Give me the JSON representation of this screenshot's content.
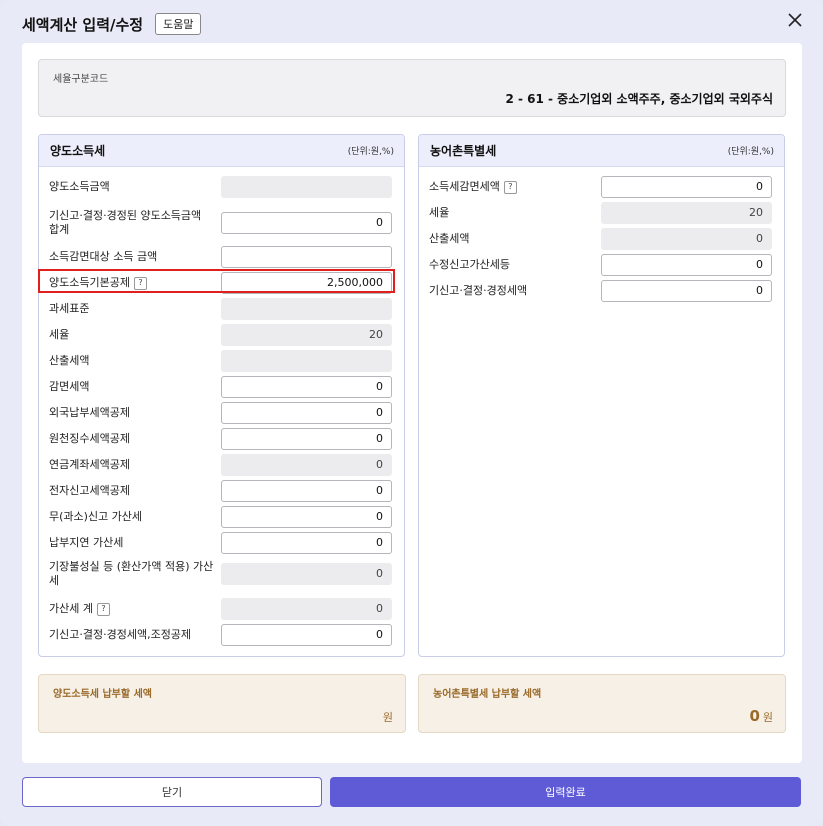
{
  "dialog": {
    "title": "세액계산 입력/수정",
    "help_label": "도움말"
  },
  "classification": {
    "label": "세율구분코드",
    "value": "2 - 61 - 중소기업외 소액주주, 중소기업외 국외주식"
  },
  "left_panel": {
    "title": "양도소득세",
    "unit": "(단위:원,%)",
    "rows": [
      {
        "label": "양도소득금액",
        "value": "",
        "readonly": true
      },
      {
        "label": "기신고·결정·경정된 양도소득금액 합계",
        "value": "0",
        "readonly": false
      },
      {
        "label": "소득감면대상 소득 금액",
        "value": "",
        "readonly": false
      },
      {
        "label": "양도소득기본공제",
        "value": "2,500,000",
        "readonly": false,
        "help": "?"
      },
      {
        "label": "과세표준",
        "value": "",
        "readonly": true
      },
      {
        "label": "세율",
        "value": "20",
        "readonly": true
      },
      {
        "label": "산출세액",
        "value": "",
        "readonly": true
      },
      {
        "label": "감면세액",
        "value": "0",
        "readonly": false
      },
      {
        "label": "외국납부세액공제",
        "value": "0",
        "readonly": false
      },
      {
        "label": "원천징수세액공제",
        "value": "0",
        "readonly": false
      },
      {
        "label": "연금계좌세액공제",
        "value": "0",
        "readonly": true
      },
      {
        "label": "전자신고세액공제",
        "value": "0",
        "readonly": false
      },
      {
        "label": "무(과소)신고 가산세",
        "value": "0",
        "readonly": false
      },
      {
        "label": "납부지연 가산세",
        "value": "0",
        "readonly": false
      },
      {
        "label": "기장불성실 등 (환산가액 적용) 가산세",
        "value": "0",
        "readonly": true
      },
      {
        "label": "가산세 계",
        "value": "0",
        "readonly": true,
        "help": "?"
      },
      {
        "label": "기신고·결정·경정세액,조정공제",
        "value": "0",
        "readonly": false
      }
    ]
  },
  "right_panel": {
    "title": "농어촌특별세",
    "unit": "(단위:원,%)",
    "rows": [
      {
        "label": "소득세감면세액",
        "value": "0",
        "readonly": false,
        "help": "?"
      },
      {
        "label": "세율",
        "value": "20",
        "readonly": true
      },
      {
        "label": "산출세액",
        "value": "0",
        "readonly": true
      },
      {
        "label": "수정신고가산세등",
        "value": "0",
        "readonly": false
      },
      {
        "label": "기신고·결정·경정세액",
        "value": "0",
        "readonly": false
      }
    ]
  },
  "summary": {
    "left": {
      "label": "양도소득세 납부할 세액",
      "amount": "",
      "unit": "원"
    },
    "right": {
      "label": "농어촌특별세 납부할 세액",
      "amount": "0",
      "unit": "원"
    }
  },
  "buttons": {
    "close": "닫기",
    "submit": "입력완료"
  },
  "colors": {
    "primary": "#5f5bd6",
    "highlight": "#e0201c",
    "summary_text": "#9a6a2a"
  },
  "icons": {
    "close": "close-icon",
    "help": "help-icon"
  }
}
